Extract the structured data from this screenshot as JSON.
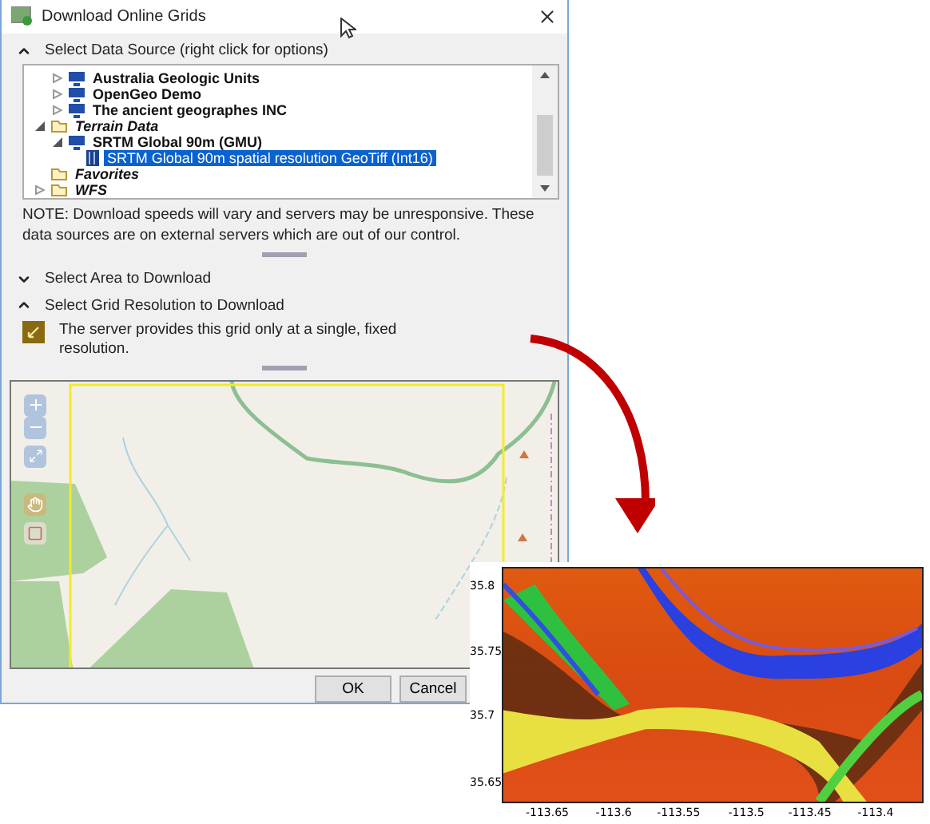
{
  "window": {
    "title": "Download Online Grids"
  },
  "sections": [
    {
      "label": "Select Data Source (right click for options)",
      "expanded": true
    },
    {
      "label": "Select Area to Download",
      "expanded": false
    },
    {
      "label": "Select Grid Resolution to Download",
      "expanded": true
    }
  ],
  "tree": {
    "items": [
      {
        "kind": "folder",
        "children": [
          {
            "kind": "server",
            "label": "Australia Geologic Units",
            "expanded": false,
            "selected": false
          },
          {
            "kind": "server",
            "label": "OpenGeo Demo",
            "expanded": false,
            "selected": false
          },
          {
            "kind": "server",
            "label": "The ancient geographes INC",
            "expanded": false,
            "selected": false
          }
        ]
      },
      {
        "kind": "folder",
        "label": "Terrain Data",
        "expanded": true,
        "children": [
          {
            "kind": "server",
            "label": "SRTM Global 90m (GMU)",
            "expanded": true,
            "selected": false,
            "children": [
              {
                "kind": "layer",
                "label": "SRTM Global 90m spatial resolution GeoTiff (Int16)",
                "selected": true
              }
            ]
          }
        ]
      },
      {
        "kind": "folder",
        "label": "Favorites",
        "selected": false
      },
      {
        "kind": "folder",
        "label": "WFS",
        "expanded": false,
        "selected": false
      }
    ]
  },
  "note": "NOTE: Download speeds will vary and servers may be unresponsive.  These data sources are on external servers which are out of our control.",
  "resolution_note": "The server provides this grid only at a single, fixed resolution.",
  "buttons": [
    "OK",
    "Cancel"
  ],
  "elevation_map": {
    "yticks": [
      "35.8",
      "35.75",
      "35.7",
      "35.65"
    ],
    "xticks": [
      "-113.65",
      "-113.6",
      "-113.55",
      "-113.5",
      "-113.45",
      "-113.4"
    ]
  }
}
